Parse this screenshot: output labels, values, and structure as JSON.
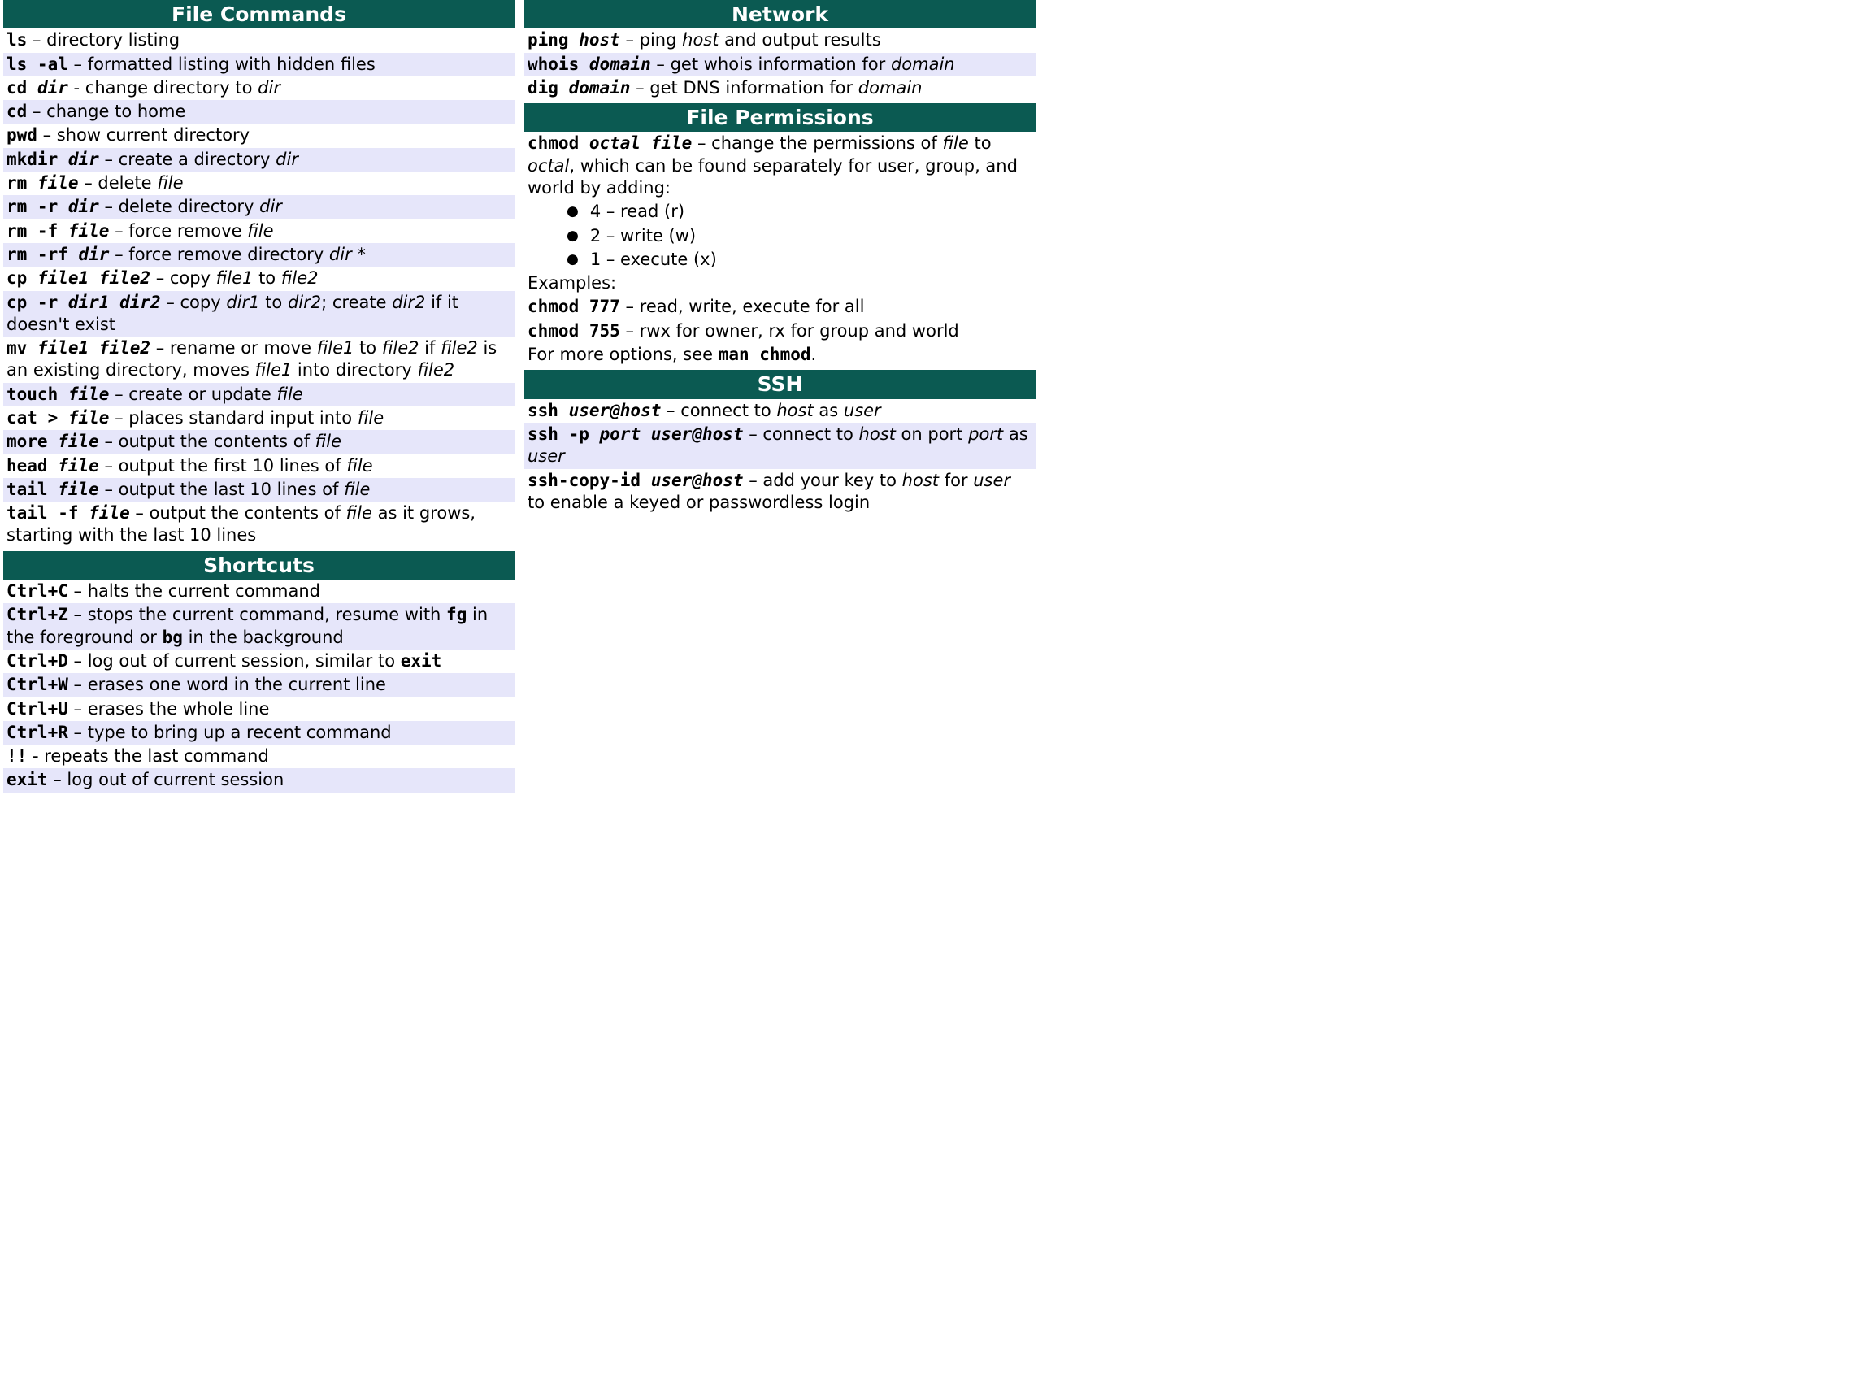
{
  "left": {
    "file_commands": {
      "title": "File Commands",
      "rows": [
        {
          "frags": [
            {
              "t": "ls",
              "c": "cmd"
            },
            {
              "t": " – directory listing"
            }
          ]
        },
        {
          "frags": [
            {
              "t": "ls -al",
              "c": "cmd"
            },
            {
              "t": " – formatted listing with hidden files"
            }
          ]
        },
        {
          "frags": [
            {
              "t": "cd ",
              "c": "cmd"
            },
            {
              "t": "dir",
              "c": "arg"
            },
            {
              "t": " - change directory to "
            },
            {
              "t": "dir",
              "c": "desc-italic"
            }
          ]
        },
        {
          "frags": [
            {
              "t": "cd",
              "c": "cmd"
            },
            {
              "t": " – change to home"
            }
          ]
        },
        {
          "frags": [
            {
              "t": "pwd",
              "c": "cmd"
            },
            {
              "t": " – show current directory"
            }
          ]
        },
        {
          "frags": [
            {
              "t": "mkdir ",
              "c": "cmd"
            },
            {
              "t": "dir",
              "c": "arg"
            },
            {
              "t": " – create a directory "
            },
            {
              "t": "dir",
              "c": "desc-italic"
            }
          ]
        },
        {
          "frags": [
            {
              "t": "rm ",
              "c": "cmd"
            },
            {
              "t": "file",
              "c": "arg"
            },
            {
              "t": " – delete "
            },
            {
              "t": "file",
              "c": "desc-italic"
            }
          ]
        },
        {
          "frags": [
            {
              "t": "rm -r ",
              "c": "cmd"
            },
            {
              "t": "dir",
              "c": "arg"
            },
            {
              "t": " – delete directory "
            },
            {
              "t": "dir",
              "c": "desc-italic"
            }
          ]
        },
        {
          "frags": [
            {
              "t": "rm -f ",
              "c": "cmd"
            },
            {
              "t": "file",
              "c": "arg"
            },
            {
              "t": " – force remove "
            },
            {
              "t": "file",
              "c": "desc-italic"
            }
          ]
        },
        {
          "frags": [
            {
              "t": "rm -rf ",
              "c": "cmd"
            },
            {
              "t": "dir",
              "c": "arg"
            },
            {
              "t": " – force remove directory "
            },
            {
              "t": "dir",
              "c": "desc-italic"
            },
            {
              "t": " *"
            }
          ]
        },
        {
          "frags": [
            {
              "t": "cp ",
              "c": "cmd"
            },
            {
              "t": "file1 file2",
              "c": "arg"
            },
            {
              "t": " – copy "
            },
            {
              "t": "file1",
              "c": "desc-italic"
            },
            {
              "t": " to "
            },
            {
              "t": "file2",
              "c": "desc-italic"
            }
          ]
        },
        {
          "frags": [
            {
              "t": "cp -r ",
              "c": "cmd"
            },
            {
              "t": "dir1 dir2",
              "c": "arg"
            },
            {
              "t": " – copy "
            },
            {
              "t": "dir1",
              "c": "desc-italic"
            },
            {
              "t": " to "
            },
            {
              "t": "dir2",
              "c": "desc-italic"
            },
            {
              "t": "; create "
            },
            {
              "t": "dir2",
              "c": "desc-italic"
            },
            {
              "t": " if it doesn't exist"
            }
          ]
        },
        {
          "frags": [
            {
              "t": "mv ",
              "c": "cmd"
            },
            {
              "t": "file1 file2",
              "c": "arg"
            },
            {
              "t": " – rename or move "
            },
            {
              "t": "file1",
              "c": "desc-italic"
            },
            {
              "t": " to "
            },
            {
              "t": "file2",
              "c": "desc-italic"
            },
            {
              "t": " if "
            },
            {
              "t": "file2",
              "c": "desc-italic"
            },
            {
              "t": " is an existing directory, moves "
            },
            {
              "t": "file1",
              "c": "desc-italic"
            },
            {
              "t": " into directory "
            },
            {
              "t": "file2",
              "c": "desc-italic"
            }
          ]
        },
        {
          "frags": [
            {
              "t": "touch ",
              "c": "cmd"
            },
            {
              "t": "file",
              "c": "arg"
            },
            {
              "t": " – create or update "
            },
            {
              "t": "file",
              "c": "desc-italic"
            }
          ]
        },
        {
          "frags": [
            {
              "t": "cat > ",
              "c": "cmd"
            },
            {
              "t": "file",
              "c": "arg"
            },
            {
              "t": " – places standard input into "
            },
            {
              "t": "file",
              "c": "desc-italic"
            }
          ]
        },
        {
          "frags": [
            {
              "t": "more ",
              "c": "cmd"
            },
            {
              "t": "file",
              "c": "arg"
            },
            {
              "t": " – output the contents of "
            },
            {
              "t": "file",
              "c": "desc-italic"
            }
          ]
        },
        {
          "frags": [
            {
              "t": "head ",
              "c": "cmd"
            },
            {
              "t": "file",
              "c": "arg"
            },
            {
              "t": " – output the first 10 lines of "
            },
            {
              "t": "file",
              "c": "desc-italic"
            }
          ]
        },
        {
          "frags": [
            {
              "t": "tail ",
              "c": "cmd"
            },
            {
              "t": "file",
              "c": "arg"
            },
            {
              "t": " – output the last 10 lines of "
            },
            {
              "t": "file",
              "c": "desc-italic"
            }
          ]
        },
        {
          "frags": [
            {
              "t": "tail -f ",
              "c": "cmd"
            },
            {
              "t": "file",
              "c": "arg"
            },
            {
              "t": " – output the contents of "
            },
            {
              "t": "file",
              "c": "desc-italic"
            },
            {
              "t": " as it grows, starting with the last 10 lines"
            }
          ]
        }
      ]
    },
    "shortcuts": {
      "title": "Shortcuts",
      "rows": [
        {
          "frags": [
            {
              "t": "Ctrl+C",
              "c": "cmd"
            },
            {
              "t": " – halts the current command"
            }
          ]
        },
        {
          "frags": [
            {
              "t": "Ctrl+Z",
              "c": "cmd"
            },
            {
              "t": " – stops the current command, resume with "
            },
            {
              "t": "fg",
              "c": "cmd"
            },
            {
              "t": " in the foreground or "
            },
            {
              "t": "bg",
              "c": "cmd"
            },
            {
              "t": " in the background"
            }
          ]
        },
        {
          "frags": [
            {
              "t": "Ctrl+D",
              "c": "cmd"
            },
            {
              "t": " – log out of current session, similar to "
            },
            {
              "t": "exit",
              "c": "cmd"
            }
          ]
        },
        {
          "frags": [
            {
              "t": "Ctrl+W",
              "c": "cmd"
            },
            {
              "t": " – erases one word in the current line"
            }
          ]
        },
        {
          "frags": [
            {
              "t": "Ctrl+U",
              "c": "cmd"
            },
            {
              "t": " – erases the whole line"
            }
          ]
        },
        {
          "frags": [
            {
              "t": "Ctrl+R",
              "c": "cmd"
            },
            {
              "t": " – type to bring up a recent command"
            }
          ]
        },
        {
          "frags": [
            {
              "t": "!!",
              "c": "cmd"
            },
            {
              "t": " - repeats the last command"
            }
          ]
        },
        {
          "frags": [
            {
              "t": "exit",
              "c": "cmd"
            },
            {
              "t": " – log out of current session"
            }
          ]
        }
      ]
    }
  },
  "right": {
    "network": {
      "title": "Network",
      "rows": [
        {
          "frags": [
            {
              "t": "ping ",
              "c": "cmd"
            },
            {
              "t": "host",
              "c": "arg"
            },
            {
              "t": " – ping "
            },
            {
              "t": "host",
              "c": "desc-italic"
            },
            {
              "t": " and output results"
            }
          ]
        },
        {
          "frags": [
            {
              "t": "whois ",
              "c": "cmd"
            },
            {
              "t": "domain",
              "c": "arg"
            },
            {
              "t": " – get whois information for "
            },
            {
              "t": "domain",
              "c": "desc-italic"
            }
          ]
        },
        {
          "frags": [
            {
              "t": "dig ",
              "c": "cmd"
            },
            {
              "t": "domain",
              "c": "arg"
            },
            {
              "t": " – get DNS information for "
            },
            {
              "t": "domain",
              "c": "desc-italic"
            }
          ]
        }
      ]
    },
    "file_permissions": {
      "title": "File Permissions",
      "intro": {
        "frags": [
          {
            "t": "chmod ",
            "c": "cmd"
          },
          {
            "t": "octal file",
            "c": "arg"
          },
          {
            "t": " – change the permissions of "
          },
          {
            "t": "file",
            "c": "desc-italic"
          },
          {
            "t": " to "
          },
          {
            "t": "octal",
            "c": "desc-italic"
          },
          {
            "t": ", which can be found separately for user, group, and world by adding:"
          }
        ]
      },
      "bullets": [
        {
          "frags": [
            {
              "t": "4 – read (r)"
            }
          ]
        },
        {
          "frags": [
            {
              "t": "2 – write (w)"
            }
          ]
        },
        {
          "frags": [
            {
              "t": "1 – execute (x)"
            }
          ]
        }
      ],
      "examples_label": "Examples:",
      "examples": [
        {
          "frags": [
            {
              "t": "chmod 777",
              "c": "cmd"
            },
            {
              "t": " – read, write, execute for all"
            }
          ]
        },
        {
          "frags": [
            {
              "t": "chmod 755",
              "c": "cmd"
            },
            {
              "t": " – rwx for owner, rx for group and world"
            }
          ]
        }
      ],
      "footer": {
        "frags": [
          {
            "t": "For more options, see "
          },
          {
            "t": "man chmod",
            "c": "cmd"
          },
          {
            "t": "."
          }
        ]
      }
    },
    "ssh": {
      "title": "SSH",
      "rows": [
        {
          "frags": [
            {
              "t": "ssh ",
              "c": "cmd"
            },
            {
              "t": "user@host",
              "c": "arg"
            },
            {
              "t": " – connect to "
            },
            {
              "t": "host",
              "c": "desc-italic"
            },
            {
              "t": " as "
            },
            {
              "t": "user",
              "c": "desc-italic"
            }
          ]
        },
        {
          "frags": [
            {
              "t": "ssh -p ",
              "c": "cmd"
            },
            {
              "t": "port user@host",
              "c": "arg"
            },
            {
              "t": " – connect to "
            },
            {
              "t": "host",
              "c": "desc-italic"
            },
            {
              "t": " on port "
            },
            {
              "t": "port",
              "c": "desc-italic"
            },
            {
              "t": " as "
            },
            {
              "t": "user",
              "c": "desc-italic"
            }
          ]
        },
        {
          "frags": [
            {
              "t": "ssh-copy-id ",
              "c": "cmd"
            },
            {
              "t": "user@host",
              "c": "arg"
            },
            {
              "t": " – add your key to "
            },
            {
              "t": "host",
              "c": "desc-italic"
            },
            {
              "t": " for "
            },
            {
              "t": "user",
              "c": "desc-italic"
            },
            {
              "t": " to enable a keyed or passwordless login"
            }
          ]
        }
      ]
    }
  }
}
